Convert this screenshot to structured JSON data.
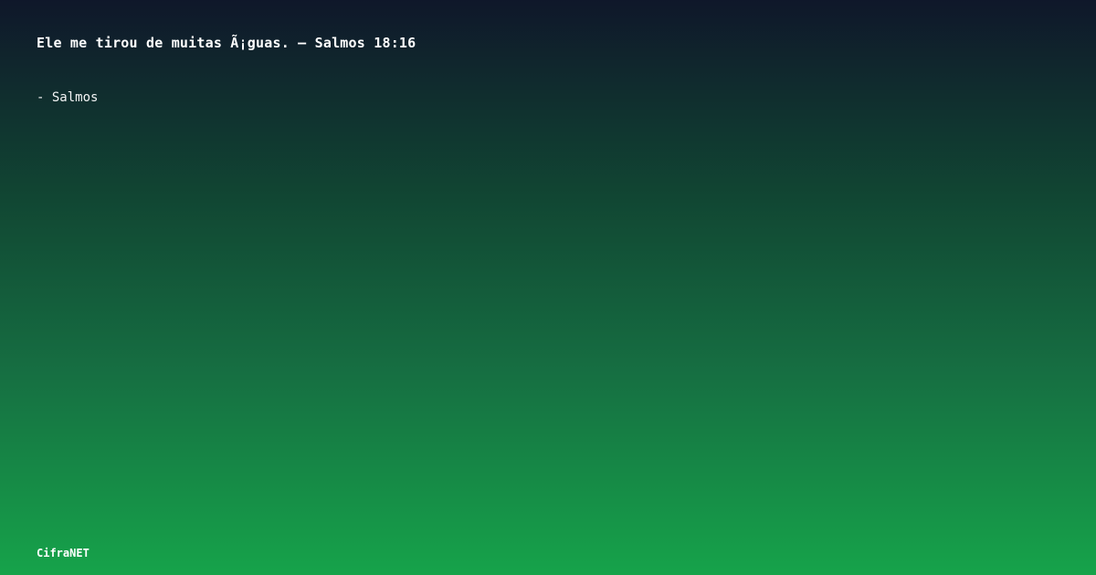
{
  "quote": {
    "text": "Ele me tirou de muitas Ã¡guas. — Salmos 18:16"
  },
  "attribution": {
    "text": "- Salmos"
  },
  "brand": {
    "text": "CifraNET"
  },
  "colors": {
    "gradient_top": "#0f172a",
    "gradient_bottom": "#16a34a",
    "text": "#ffffff"
  }
}
